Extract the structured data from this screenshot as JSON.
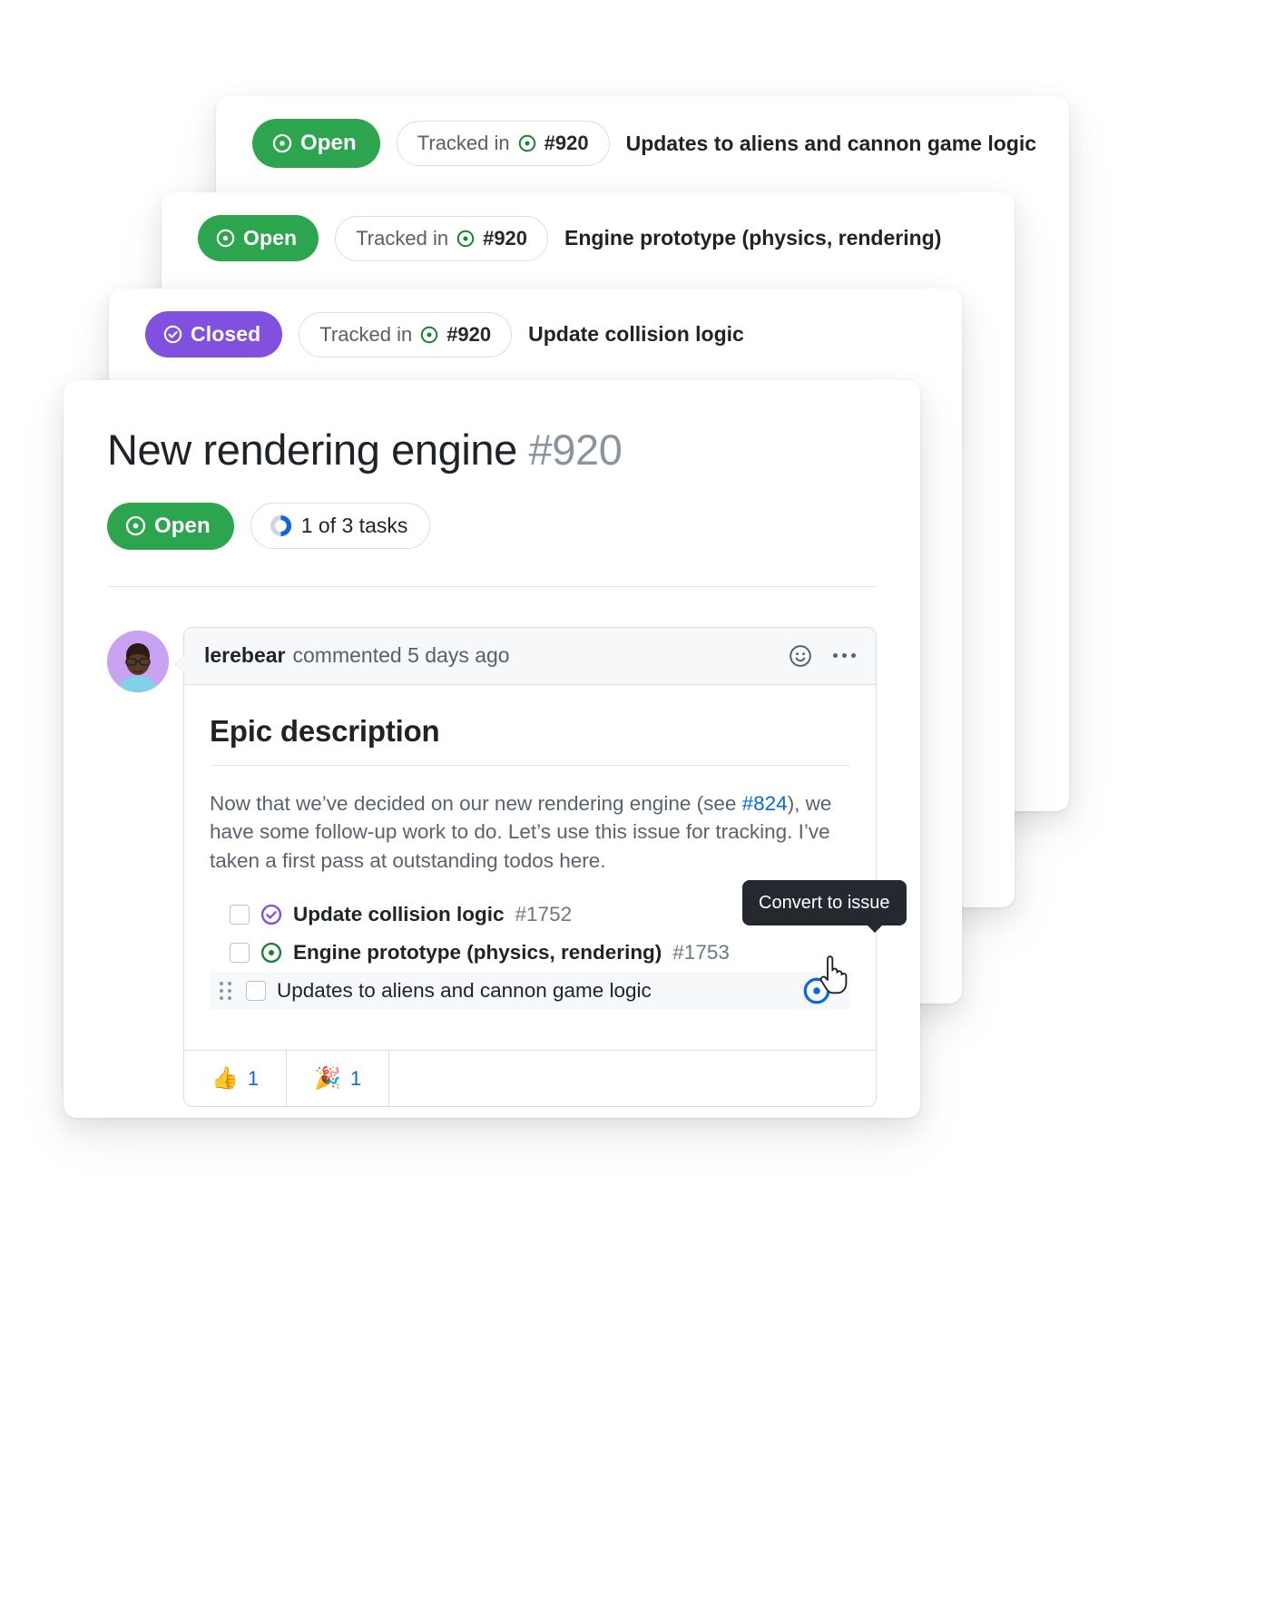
{
  "stacked_cards": [
    {
      "status_label": "Open",
      "status_type": "open",
      "tracked_label": "Tracked in",
      "tracked_number": "#920",
      "title": "Updates to aliens and cannon game logic"
    },
    {
      "status_label": "Open",
      "status_type": "open",
      "tracked_label": "Tracked in",
      "tracked_number": "#920",
      "title": "Engine prototype (physics, rendering)"
    },
    {
      "status_label": "Closed",
      "status_type": "closed",
      "tracked_label": "Tracked in",
      "tracked_number": "#920",
      "title": "Update collision logic"
    }
  ],
  "issue": {
    "title": "New rendering engine",
    "number": "#920",
    "status_label": "Open",
    "tasks_progress": "1 of 3 tasks",
    "tasks_done": 1,
    "tasks_total": 3
  },
  "comment": {
    "author": "lerebear",
    "meta": "commented 5 days ago",
    "emoji_icon": "smiley-icon",
    "menu_icon": "kebab-menu-icon",
    "heading": "Epic description",
    "paragraph_before_link": "Now that we’ve decided on our new rendering engine (see ",
    "link_text": "#824",
    "paragraph_after_link": "), we have some follow-up work to do. Let’s use this issue for tracking. I’ve taken a first pass at outstanding todos here.",
    "tasks": [
      {
        "checked": false,
        "state_icon": "issue-closed-completed-icon",
        "state_color": "#8250df",
        "label": "Update collision logic",
        "number": "#1752",
        "bold": true,
        "hover": false
      },
      {
        "checked": false,
        "state_icon": "issue-opened-icon",
        "state_color": "#1a7f37",
        "label": "Engine prototype (physics, rendering)",
        "number": "#1753",
        "bold": true,
        "hover": false
      },
      {
        "checked": false,
        "state_icon": "",
        "state_color": "",
        "label": "Updates to aliens and cannon game logic",
        "number": "",
        "bold": false,
        "hover": true
      }
    ],
    "tooltip": "Convert to issue",
    "convert_icon": "convert-to-issue-icon",
    "reactions": [
      {
        "emoji": "👍",
        "count": "1",
        "name": "thumbs-up"
      },
      {
        "emoji": "🎉",
        "count": "1",
        "name": "party-popper"
      }
    ]
  },
  "colors": {
    "open_green": "#2da44e",
    "closed_purple": "#8250df",
    "link_blue": "#0969da",
    "progress_blue": "#0969da",
    "text": "#1f2328",
    "muted": "#57606a"
  }
}
